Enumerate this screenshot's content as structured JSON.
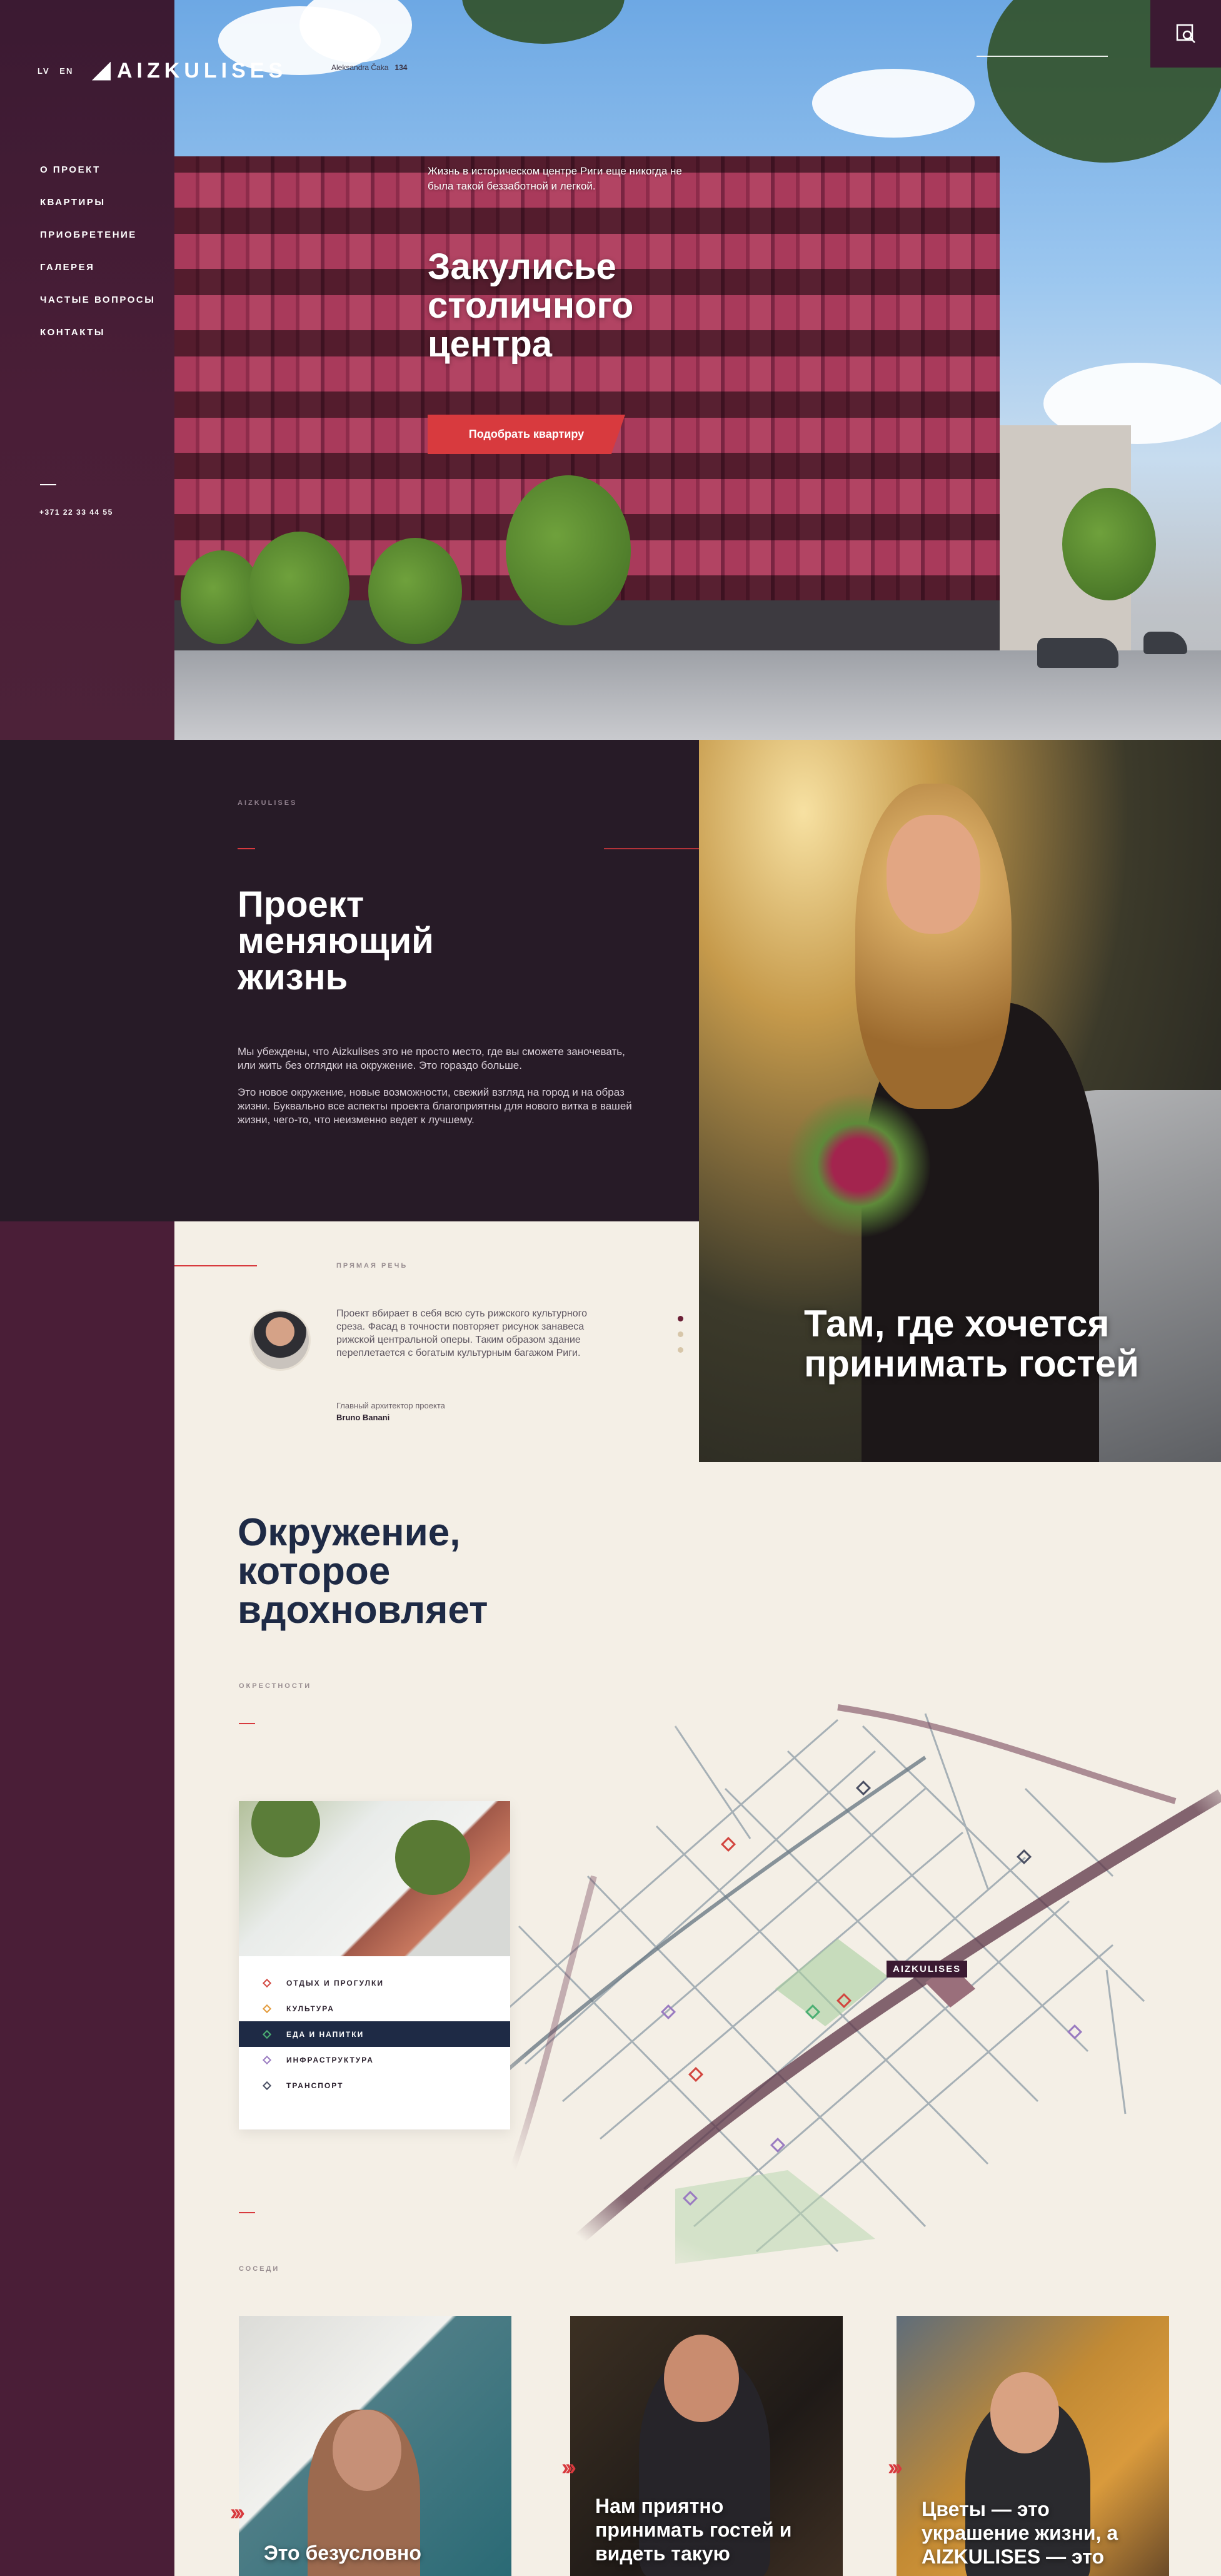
{
  "header": {
    "languages": [
      "LV",
      "EN"
    ],
    "logo": "AIZKULISES",
    "address_street": "Aleksandra Čaka",
    "address_number": "134"
  },
  "nav": {
    "items": [
      "О ПРОЕКТ",
      "КВАРТИРЫ",
      "ПРИОБРЕТЕНИЕ",
      "ГАЛЕРЕЯ",
      "ЧАСТЫЕ ВОПРОСЫ",
      "КОНТАКТЫ"
    ],
    "phone": "+371 22 33 44 55"
  },
  "hero": {
    "tagline": "Жизнь в историческом центре Риги еще никогда не была такой беззаботной и легкой.",
    "title_l1": "Закулисье",
    "title_l2": "столичного",
    "title_l3": "центра",
    "cta": "Подобрать квартиру"
  },
  "about": {
    "eyebrow": "AIZKULISES",
    "title_l1": "Проект",
    "title_l2": "меняющий",
    "title_l3": "жизнь",
    "p1": "Мы убеждены, что Aizkulises это не просто место, где вы сможете заночевать, или жить без оглядки на окружение. Это гораздо больше.",
    "p2": "Это новое окружение, новые возможности, свежий взгляд на город и на образ жизни. Буквально все аспекты проекта благоприятны для нового витка в вашей жизни, чего-то, что неизменно ведет к лучшему."
  },
  "feature": {
    "caption_l1": "Там, где хочется",
    "caption_l2": "принимать гостей"
  },
  "quote": {
    "eyebrow": "ПРЯМАЯ РЕЧЬ",
    "text": "Проект вбирает в себя всю суть рижского культурного среза. Фасад в точности повторяет рисунок занавеса рижской центральной оперы. Таким образом здание переплетается с богатым культурным багажом Риги.",
    "role": "Главный архитектор проекта",
    "name": "Bruno Banani"
  },
  "surroundings": {
    "title_l1": "Окружение,",
    "title_l2": "которое",
    "title_l3": "вдохновляет",
    "eyebrow": "ОКРЕСТНОСТИ",
    "map_label": "AIZKULISES",
    "legend": [
      {
        "label": "ОТДЫХ И ПРОГУЛКИ",
        "color": "#d2463f"
      },
      {
        "label": "КУЛЬТУРА",
        "color": "#e39a3a"
      },
      {
        "label": "ЕДА И НАПИТКИ",
        "color": "#4caf73"
      },
      {
        "label": "ИНФРАСТРУКТУРА",
        "color": "#9a7bc1"
      },
      {
        "label": "ТРАНСПОРТ",
        "color": "#4a4f63"
      }
    ],
    "active_legend": "ЕДА И НАПИТКИ"
  },
  "neighbours": {
    "eyebrow": "СОСЕДИ",
    "cards": [
      {
        "caption": "Это безусловно"
      },
      {
        "caption": "Нам приятно принимать гостей и видеть такую"
      },
      {
        "caption": "Цветы — это украшение жизни, а AIZKULISES — это"
      }
    ]
  },
  "colors": {
    "sidebar": "#3b1a32",
    "accent": "#d83a3e",
    "dark_panel": "#271b27",
    "navy": "#1e2a45",
    "cream": "#f4efe6"
  }
}
